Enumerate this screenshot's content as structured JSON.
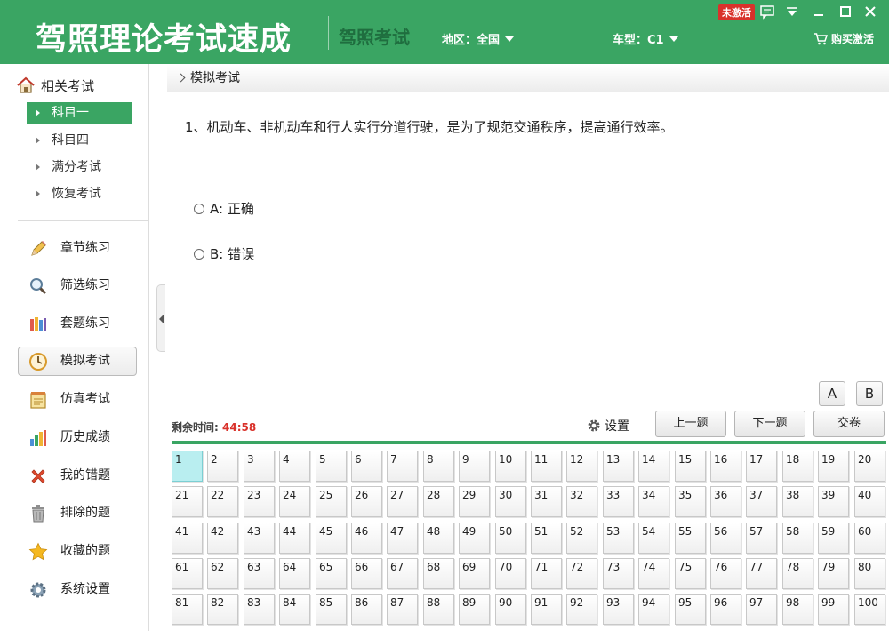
{
  "header": {
    "app_title": "驾照理论考试速成",
    "sub_title": "驾照考试",
    "region": "地区：全国",
    "car_type": "车型：C1",
    "buy": "购买激活",
    "badge": "未激活",
    "brand_color": "#3aa563"
  },
  "sidebar": {
    "heading": "相关考试",
    "sub_items": [
      {
        "label": "科目一",
        "active": true
      },
      {
        "label": "科目四",
        "active": false
      },
      {
        "label": "满分考试",
        "active": false
      },
      {
        "label": "恢复考试",
        "active": false
      }
    ],
    "nav_items": [
      {
        "label": "章节练习",
        "icon": "pencil-icon"
      },
      {
        "label": "筛选练习",
        "icon": "magnifier-icon"
      },
      {
        "label": "套题练习",
        "icon": "books-icon"
      },
      {
        "label": "模拟考试",
        "icon": "clock-icon",
        "active": true
      },
      {
        "label": "仿真考试",
        "icon": "notepad-icon"
      },
      {
        "label": "历史成绩",
        "icon": "bar-chart-icon"
      },
      {
        "label": "我的错题",
        "icon": "red-x-icon"
      },
      {
        "label": "排除的题",
        "icon": "trash-icon"
      },
      {
        "label": "收藏的题",
        "icon": "star-icon"
      },
      {
        "label": "系统设置",
        "icon": "gear-icon"
      }
    ]
  },
  "main": {
    "breadcrumb": "模拟考试",
    "question": "1、机动车、非机动车和行人实行分道行驶，是为了规范交通秩序，提高通行效率。",
    "options": [
      "A: 正确",
      "B: 错误"
    ],
    "answer_buttons": [
      "A",
      "B"
    ],
    "timer_label": "剩余时间:",
    "timer_value": "44:58",
    "settings_label": "设置",
    "prev_label": "上一题",
    "next_label": "下一题",
    "submit_label": "交卷",
    "current_question": 1,
    "total_questions": 100
  }
}
